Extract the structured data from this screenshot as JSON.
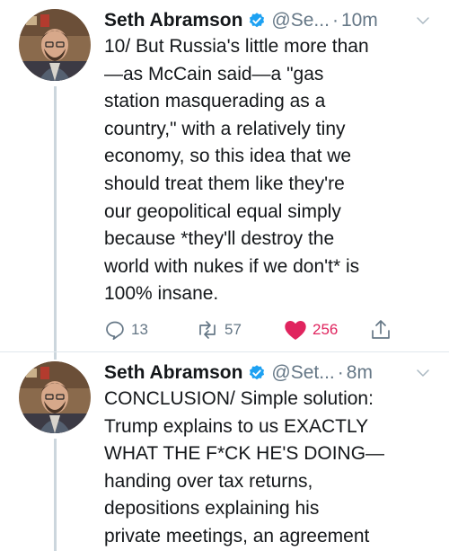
{
  "tweet1": {
    "name": "Seth Abramson",
    "handle": "@Se...",
    "separator": "·",
    "time": "10m",
    "text": "10/ But Russia's little more than\n—as McCain said—a \"gas\nstation masquerading as a\ncountry,\" with a relatively tiny\neconomy, so this idea that we\nshould treat them like they're\nour geopolitical equal simply\nbecause *they'll destroy the\nworld with nukes if we don't* is\n100% insane.",
    "replies": "13",
    "retweets": "57",
    "likes": "256",
    "liked": true
  },
  "tweet2": {
    "name": "Seth Abramson",
    "handle": "@Set...",
    "separator": "·",
    "time": "8m",
    "text": "CONCLUSION/ Simple solution:\nTrump explains to us EXACTLY\nWHAT THE F*CK HE'S DOING—\nhanding over tax returns,\ndepositions explaining his\nprivate meetings, an agreement"
  },
  "colors": {
    "verified": "#1da1f2",
    "like": "#e0245e",
    "muted": "#657786",
    "thread": "#ccd6dd"
  },
  "icons": [
    "verified-badge-icon",
    "chevron-down-icon",
    "reply-icon",
    "retweet-icon",
    "heart-icon",
    "share-icon"
  ]
}
